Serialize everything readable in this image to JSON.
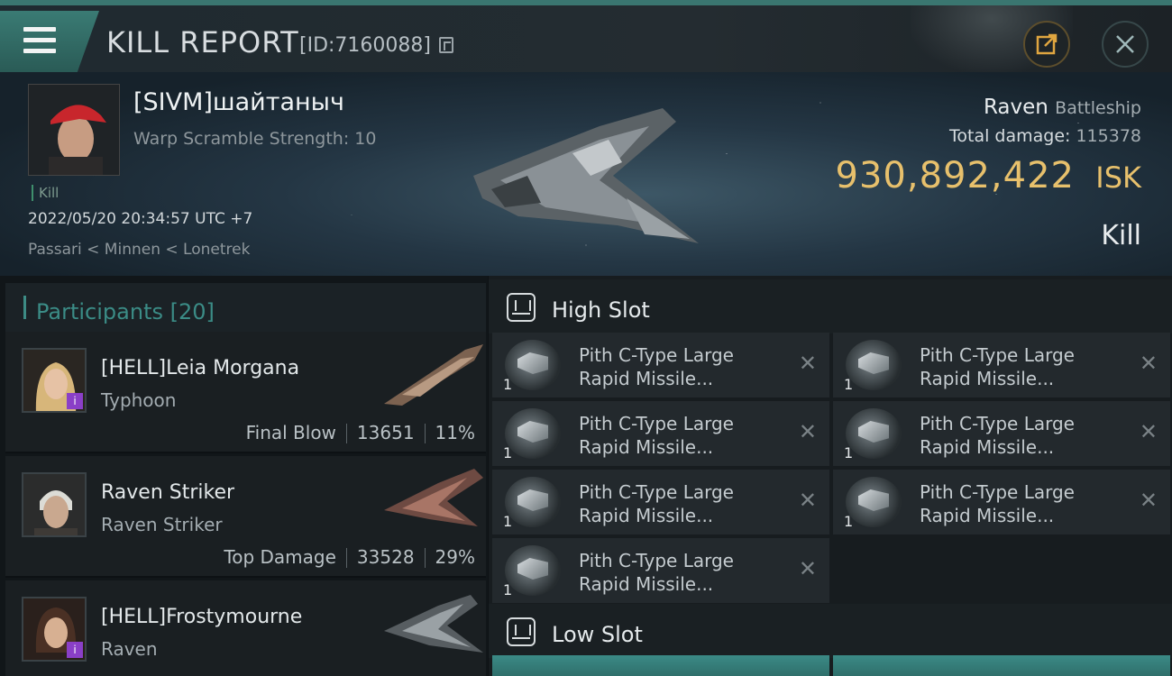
{
  "header": {
    "title": "KILL REPORT",
    "report_id": "[ID:7160088]",
    "icons": {
      "menu": "menu-icon",
      "copy": "copy-icon",
      "share": "share-icon",
      "close": "close-icon"
    }
  },
  "victim": {
    "name": "[SIVM]шайтаныч",
    "subtitle": "Warp Scramble Strength: 10",
    "tag": "Kill",
    "timestamp": "2022/05/20 20:34:57 UTC +7",
    "location": "Passari < Minnen < Lonetrek",
    "ship_name": "Raven",
    "ship_class": "Battleship",
    "total_damage_label": "Total damage:",
    "total_damage": "115378",
    "isk_value": "930,892,422",
    "isk_unit": "ISK",
    "result": "Kill"
  },
  "participants": {
    "label": "Participants",
    "count": "[20]",
    "rows": [
      {
        "name": "[HELL]Leia Morgana",
        "ship": "Typhoon",
        "role": "Final Blow",
        "damage": "13651",
        "percent": "11%",
        "badge": "i"
      },
      {
        "name": "Raven Striker",
        "ship": "Raven Striker",
        "role": "Top Damage",
        "damage": "33528",
        "percent": "29%",
        "badge": ""
      },
      {
        "name": "[HELL]Frostymourne",
        "ship": "Raven",
        "role": "",
        "damage": "",
        "percent": "",
        "badge": "i"
      }
    ]
  },
  "slots": {
    "high": {
      "title": "High Slot",
      "modules": [
        {
          "line1": "Pith C-Type Large",
          "line2": "Rapid Missile...",
          "qty": "1"
        },
        {
          "line1": "Pith C-Type Large",
          "line2": "Rapid Missile...",
          "qty": "1"
        },
        {
          "line1": "Pith C-Type Large",
          "line2": "Rapid Missile...",
          "qty": "1"
        },
        {
          "line1": "Pith C-Type Large",
          "line2": "Rapid Missile...",
          "qty": "1"
        },
        {
          "line1": "Pith C-Type Large",
          "line2": "Rapid Missile...",
          "qty": "1"
        },
        {
          "line1": "Pith C-Type Large",
          "line2": "Rapid Missile...",
          "qty": "1"
        },
        {
          "line1": "Pith C-Type Large",
          "line2": "Rapid Missile...",
          "qty": "1"
        }
      ]
    },
    "low": {
      "title": "Low Slot"
    }
  },
  "colors": {
    "accent": "#3d8c85",
    "isk": "#e7c06c",
    "badge": "#8a3fc7"
  }
}
